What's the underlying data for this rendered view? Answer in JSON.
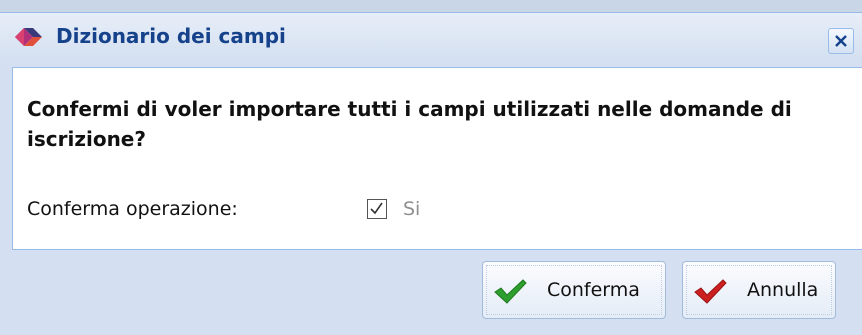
{
  "dialog": {
    "title": "Dizionario dei campi",
    "icon": "diamond-app-icon",
    "close_icon": "close-x-icon"
  },
  "body": {
    "question": "Confermi di voler importare tutti i campi utilizzati nelle domande di iscrizione?",
    "field_label": "Conferma operazione:",
    "checkbox": {
      "checked": true,
      "label": "Si"
    }
  },
  "buttons": {
    "confirm": {
      "label": "Conferma",
      "icon": "green-check-icon"
    },
    "cancel": {
      "label": "Annulla",
      "icon": "red-check-icon"
    }
  },
  "colors": {
    "title_text": "#15428b",
    "dialog_bg": "#d4e0f1",
    "border": "#99bbe8",
    "confirm_icon": "#2e9e2e",
    "cancel_icon": "#cc1f1f"
  }
}
